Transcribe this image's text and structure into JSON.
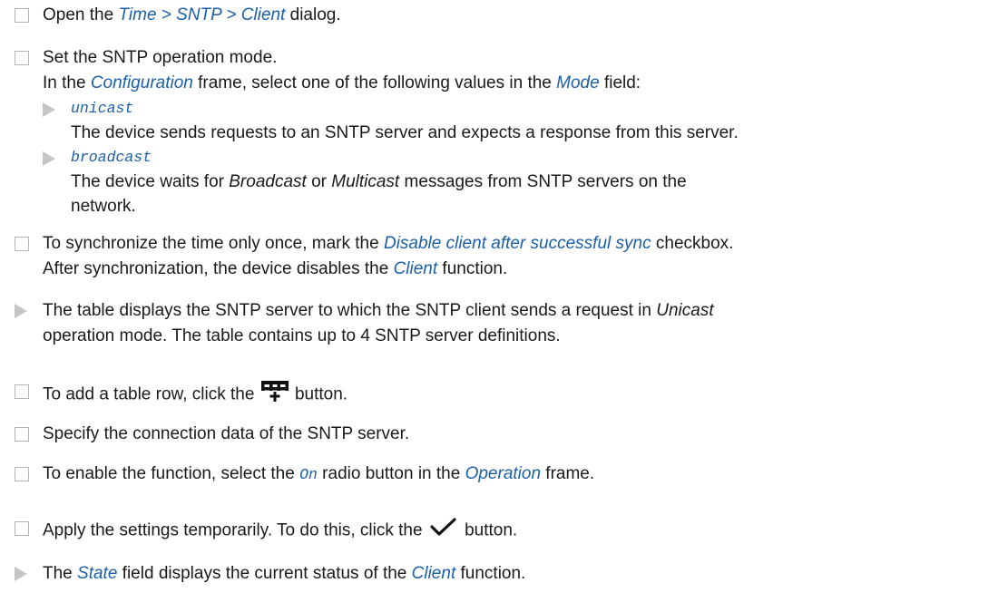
{
  "step_open": {
    "pre": "Open the ",
    "path": "Time > SNTP > Client",
    "post": " dialog."
  },
  "step_mode": {
    "title": "Set the SNTP operation mode.",
    "line2_pre": "In the ",
    "frame_name": "Configuration",
    "line2_mid": " frame, select one of the following values in the ",
    "field_name": "Mode",
    "line2_post": " field:"
  },
  "mode_options": [
    {
      "value": "unicast",
      "desc": "The device sends requests to an SNTP server and expects a response from this server."
    },
    {
      "value": "broadcast",
      "desc_pre": "The device waits for ",
      "desc_b": "Broadcast",
      "desc_mid": " or ",
      "desc_m": "Multicast",
      "desc_post": " messages from SNTP servers on the",
      "desc_line2": "network."
    }
  ],
  "step_once": {
    "pre": "To synchronize the time only once, mark the ",
    "checkbox_name": "Disable client after successful sync",
    "post": " checkbox.",
    "line2_pre": "After synchronization, the device disables the ",
    "function_name": "Client",
    "line2_post": " function."
  },
  "result_table": {
    "pre": "The table displays the SNTP server to which the SNTP client sends a request in ",
    "mode_word": "Unicast",
    "line2": "operation mode. The table contains up to 4 SNTP server definitions."
  },
  "step_add": {
    "pre": "To add a table row, click the ",
    "post": " button.",
    "icon": "add-table-row-icon"
  },
  "step_specify": {
    "text": "Specify the connection data of the SNTP server."
  },
  "step_enable": {
    "pre": "To enable the function, select the ",
    "radio_value": "On",
    "mid": " radio button in the ",
    "frame_name": "Operation",
    "post": " frame."
  },
  "step_apply": {
    "pre": "Apply the settings temporarily. To do this, click the ",
    "post": " button.",
    "icon": "checkmark-icon"
  },
  "result_state": {
    "pre": "The ",
    "field_name": "State",
    "mid": " field displays the current status of the ",
    "function_name": "Client",
    "post": " function."
  }
}
